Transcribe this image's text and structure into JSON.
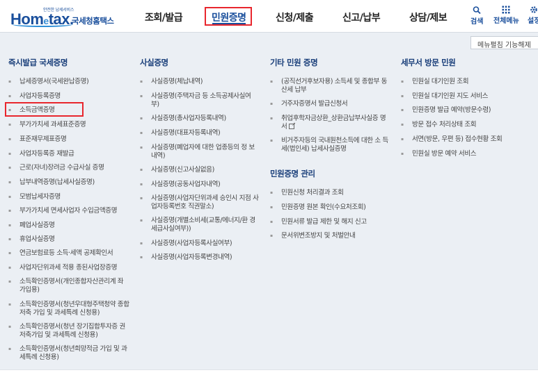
{
  "header": {
    "logo_small": "안전한 납세서비스",
    "logo_main_1": "Hom",
    "logo_main_e": "e",
    "logo_main_2": "tax.",
    "logo_sub": "국세청홈택스",
    "menu": [
      "조회/발급",
      "민원증명",
      "신청/제출",
      "신고/납부",
      "상담/제보"
    ],
    "active_menu": "민원증명",
    "utils": [
      {
        "icon": "search-icon",
        "label": "검색"
      },
      {
        "icon": "grid-menu-icon",
        "label": "전체메뉴"
      },
      {
        "icon": "gear-icon",
        "label": "설정"
      }
    ]
  },
  "toggle_label": "메뉴펼침 기능해제",
  "columns": [
    {
      "title": "즉시발급 국세증명",
      "items": [
        "납세증명서(국세완납증명)",
        "사업자등록증명",
        "소득금액증명",
        "부가가치세 과세표준증명",
        "표준재무제표증명",
        "사업자등록증 재발급",
        "근로(자녀)장려금 수급사실 증명",
        "납부내역증명(납세사실증명)",
        "모범납세자증명",
        "부가가치세 면세사업자 수입금액증명",
        "폐업사실증명",
        "휴업사실증명",
        "연금보험료등 소득·세액 공제확인서",
        "사업자단위과세 적용 종된사업장증명",
        "소득확인증명서(개인종합자산관리계 좌 가입용)",
        "소득확인증명서(청년우대형주택청약 종합저축 가입 및 과세특례 신청용)",
        "소득확인증명서(청년 장기집합투자증 권저축가입 및 과세특례 신청용)",
        "소득확인증명서(청년희망적금 가입 및 과세특례 신청용)"
      ]
    },
    {
      "title": "사실증명",
      "items": [
        "사실증명(체납내역)",
        "사실증명(주택자금 등 소득공제사실여 부)",
        "사실증명(총사업자등록내역)",
        "사실증명(대표자등록내역)",
        "사실증명(폐업자에 대한 업종등의 정 보내역)",
        "사실증명(신고사실없음)",
        "사실증명(공동사업자내역)",
        "사실증명(사업자단위과세 승인시 지점 사업자등록번호 직권말소)",
        "사실증명(개별소비세(교통/에너지/환 경세급사실여부))",
        "사실증명(사업자등록사실여부)",
        "사실증명(사업자등록변경내역)"
      ]
    },
    {
      "title": "기타 민원 증명",
      "items": [
        "(공직선거후보자용) 소득세 및 종합부 동산세 납부",
        "거주자증명서 발급신청서",
        "취업후학자금상환_상환금납부사실증 명서",
        "비거주자등의 국내원천소득에 대한 소 득세(법인세) 납세사실증명"
      ],
      "title2": "민원증명 관리",
      "items2": [
        "민원신청 처리결과 조회",
        "민원증명 원본 확인(수요처조회)",
        "민원서류 발급 제한 및 해지 신고",
        "문서위변조방지 및 처벌안내"
      ]
    },
    {
      "title": "세무서 방문 민원",
      "items": [
        "민원실 대기인원 조회",
        "민원실 대기인원 지도 서비스",
        "민원증명 발급 예약(방문수령)",
        "방문 접수 처리상태 조회",
        "서면(방문, 우편 등) 접수현황 조회",
        "민원실 방문 예약 서비스"
      ]
    }
  ],
  "highlighted_item": "소득금액증명"
}
